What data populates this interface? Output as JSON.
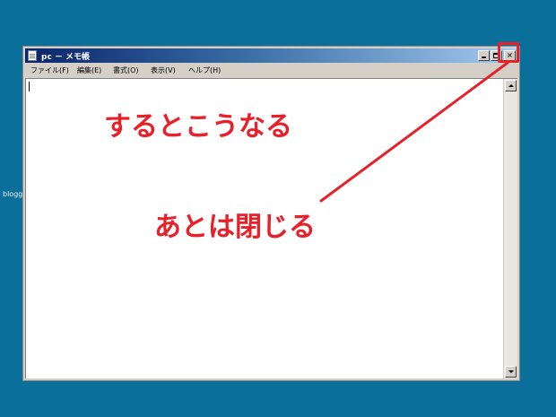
{
  "desktop": {
    "partial_icon_label": "blogg"
  },
  "window": {
    "title": "pc － メモ帳",
    "buttons": {
      "minimize": "_",
      "maximize": "□",
      "close": "×"
    }
  },
  "menu": [
    {
      "label": "ファイル(F)"
    },
    {
      "label": "編集(E)"
    },
    {
      "label": "書式(O)"
    },
    {
      "label": "表示(V)"
    },
    {
      "label": "ヘルプ(H)"
    }
  ],
  "annotations": {
    "line1": "するとこうなる",
    "line2": "あとは閉じる"
  },
  "colors": {
    "desktop": "#0b6f9b",
    "annotation": "#e8202a",
    "titlebar_start": "#0a246a",
    "titlebar_end": "#a6caf0"
  }
}
